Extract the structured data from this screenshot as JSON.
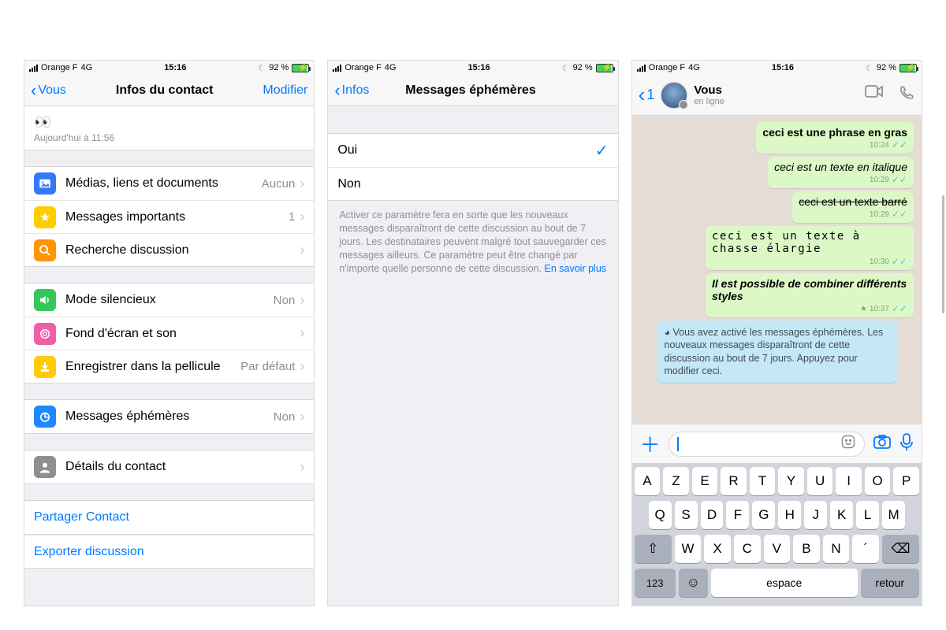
{
  "status": {
    "carrier": "Orange F",
    "network": "4G",
    "time": "15:16",
    "battery": "92 %"
  },
  "phone1": {
    "back": "Vous",
    "title": "Infos du contact",
    "action": "Modifier",
    "emoji": "👀",
    "timestamp": "Aujourd'hui à 11:56",
    "items": {
      "media": {
        "label": "Médias, liens et documents",
        "value": "Aucun"
      },
      "starred": {
        "label": "Messages importants",
        "value": "1"
      },
      "search": {
        "label": "Recherche discussion"
      },
      "mute": {
        "label": "Mode silencieux",
        "value": "Non"
      },
      "wallpaper": {
        "label": "Fond d'écran et son"
      },
      "save": {
        "label": "Enregistrer dans la pellicule",
        "value": "Par défaut"
      },
      "ephemeral": {
        "label": "Messages éphémères",
        "value": "Non"
      },
      "details": {
        "label": "Détails du contact"
      }
    },
    "actions": {
      "share": "Partager Contact",
      "export": "Exporter discussion"
    }
  },
  "phone2": {
    "back": "Infos",
    "title": "Messages éphémères",
    "options": {
      "yes": "Oui",
      "no": "Non"
    },
    "footnote": "Activer ce paramètre fera en sorte que les nouveaux messages disparaîtront de cette discussion au bout de 7 jours. Les destinataires peuvent malgré tout sauvegarder ces messages ailleurs. Ce paramètre peut être changé par n'importe quelle personne de cette discussion. ",
    "footnote_link": "En savoir plus"
  },
  "phone3": {
    "back": "1",
    "name": "Vous",
    "status": "en ligne",
    "messages": [
      {
        "text": "ceci est une phrase en gras",
        "style": "bold",
        "time": "10:24"
      },
      {
        "text": "ceci est un texte en italique",
        "style": "italic",
        "time": "10:29"
      },
      {
        "text": "ceci est un texte barré",
        "style": "strike",
        "time": "10:29"
      },
      {
        "text": "ceci est un texte à chasse élargie",
        "style": "mono",
        "time": "10:30"
      },
      {
        "text": "Il est possible de combiner différents styles",
        "style": "bolditalic",
        "time": "10:37",
        "starred": true
      }
    ],
    "system": "Vous avez activé les messages éphémères. Les nouveaux messages disparaîtront de cette discussion au bout de 7 jours. Appuyez pour modifier ceci.",
    "keyboard": {
      "row1": [
        "A",
        "Z",
        "E",
        "R",
        "T",
        "Y",
        "U",
        "I",
        "O",
        "P"
      ],
      "row2": [
        "Q",
        "S",
        "D",
        "F",
        "G",
        "H",
        "J",
        "K",
        "L",
        "M"
      ],
      "row3": [
        "W",
        "X",
        "C",
        "V",
        "B",
        "N",
        "´"
      ],
      "space": "espace",
      "num": "123",
      "return": "retour"
    }
  },
  "colors": {
    "blue": "#007aff",
    "media": "#3478f6",
    "star": "#ffcc00",
    "search": "#ff9500",
    "mute": "#34c759",
    "wallpaper": "#ee5fa7",
    "save": "#ffcc00",
    "ephemeral": "#1e88ff",
    "details": "#8e8e93"
  }
}
